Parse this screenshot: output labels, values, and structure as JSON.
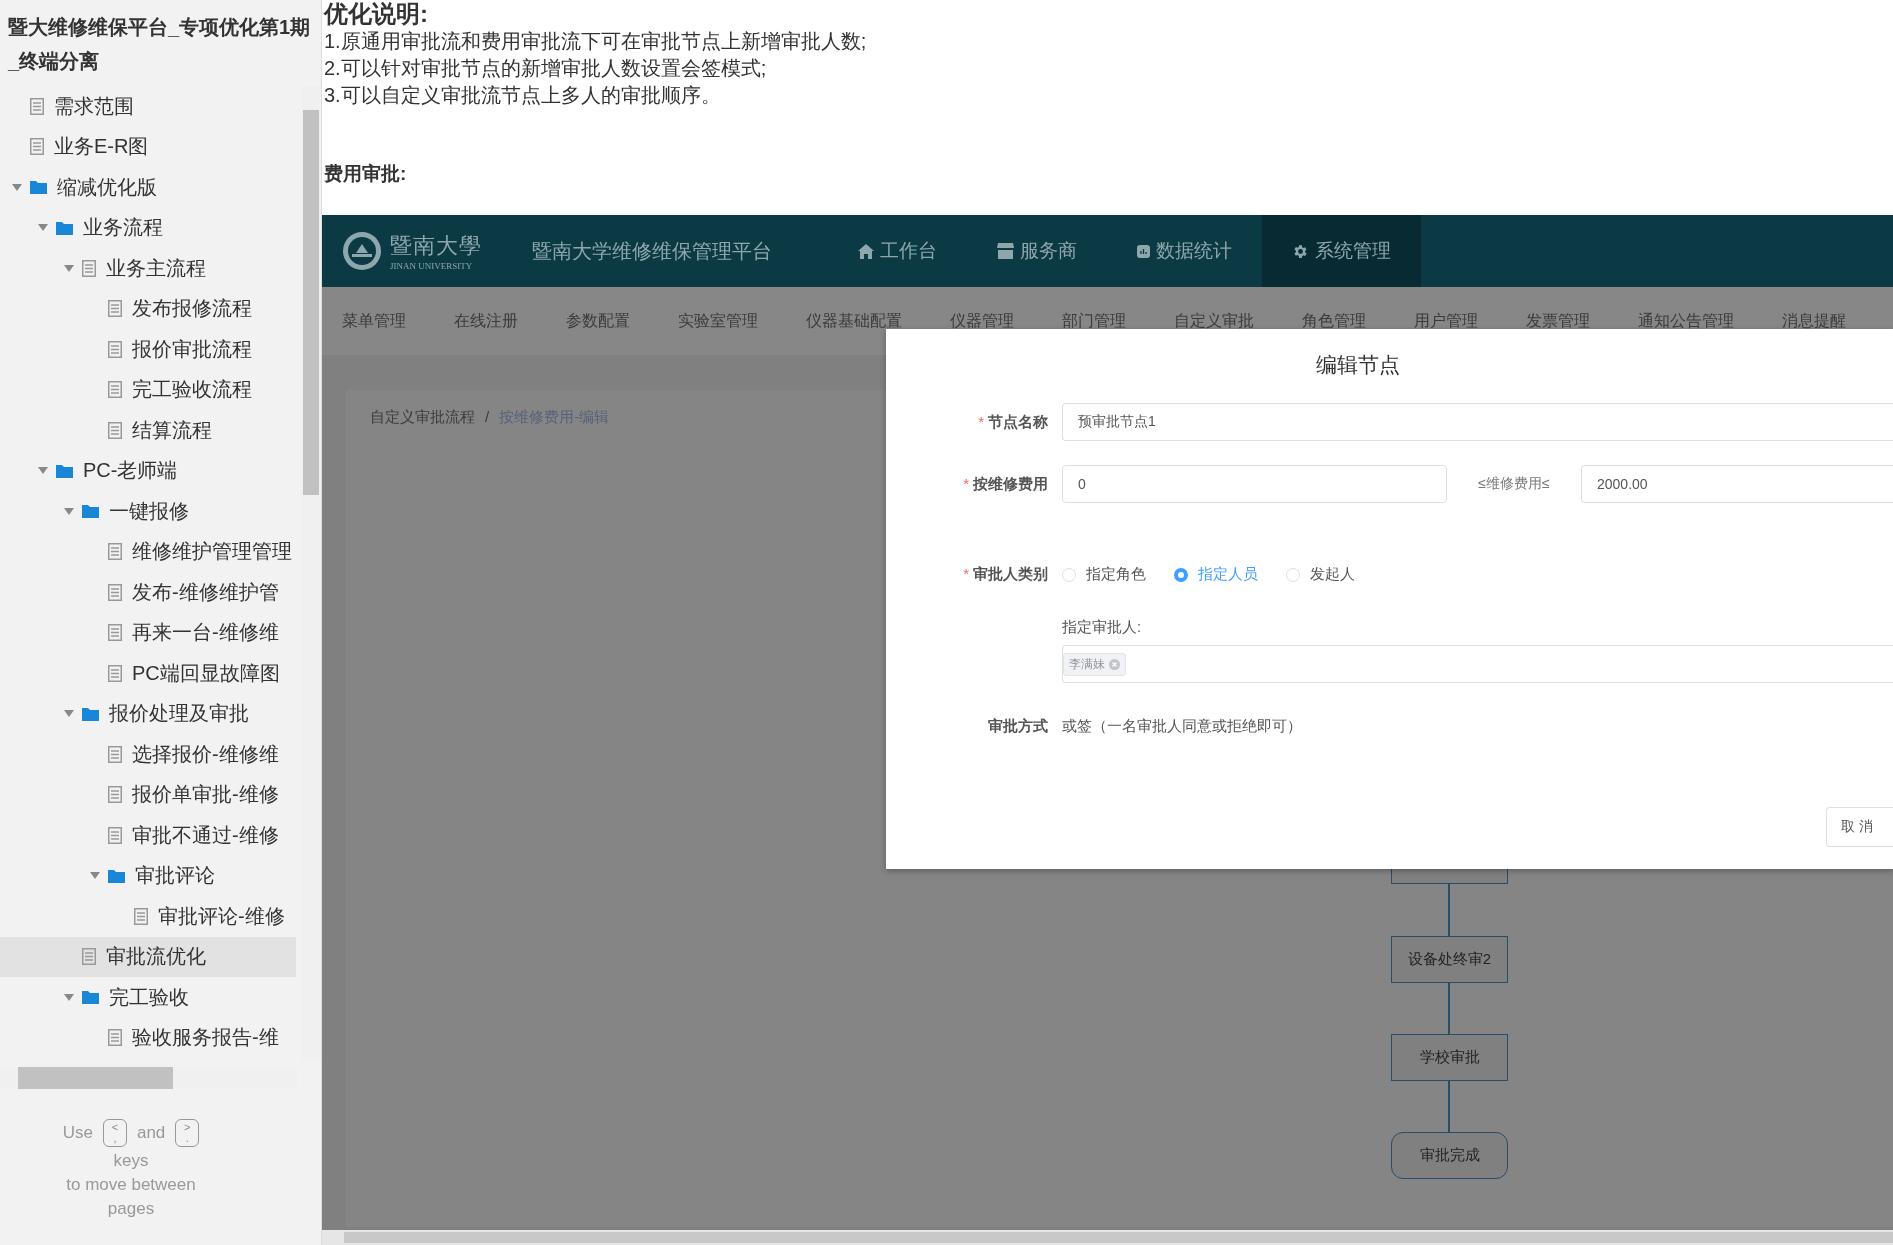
{
  "sidebar": {
    "title": "暨大维修维保平台_专项优化第1期_终端分离",
    "tree": [
      {
        "label": "需求范围",
        "kind": "page",
        "selected": false
      },
      {
        "label": "业务E-R图",
        "kind": "page",
        "selected": false
      },
      {
        "label": "缩减优化版",
        "kind": "folder",
        "expanded": true,
        "selected": false,
        "children": [
          {
            "label": "业务流程",
            "kind": "folder",
            "expanded": true,
            "selected": false,
            "children": [
              {
                "label": "业务主流程",
                "kind": "page",
                "expanded": true,
                "selected": false,
                "children": [
                  {
                    "label": "发布报修流程",
                    "kind": "page",
                    "selected": false
                  },
                  {
                    "label": "报价审批流程",
                    "kind": "page",
                    "selected": false
                  },
                  {
                    "label": "完工验收流程",
                    "kind": "page",
                    "selected": false
                  },
                  {
                    "label": "结算流程",
                    "kind": "page",
                    "selected": false
                  }
                ]
              }
            ]
          },
          {
            "label": "PC-老师端",
            "kind": "folder",
            "expanded": true,
            "selected": false,
            "children": [
              {
                "label": "一键报修",
                "kind": "folder",
                "expanded": true,
                "selected": false,
                "children": [
                  {
                    "label": "维修维护管理管理",
                    "kind": "page",
                    "selected": false
                  },
                  {
                    "label": "发布-维修维护管",
                    "kind": "page",
                    "selected": false
                  },
                  {
                    "label": "再来一台-维修维",
                    "kind": "page",
                    "selected": false
                  },
                  {
                    "label": "PC端回显故障图",
                    "kind": "page",
                    "selected": false
                  }
                ]
              },
              {
                "label": "报价处理及审批",
                "kind": "folder",
                "expanded": true,
                "selected": false,
                "children": [
                  {
                    "label": "选择报价-维修维",
                    "kind": "page",
                    "selected": false
                  },
                  {
                    "label": "报价单审批-维修",
                    "kind": "page",
                    "selected": false
                  },
                  {
                    "label": "审批不通过-维修",
                    "kind": "page",
                    "selected": false
                  },
                  {
                    "label": "审批评论",
                    "kind": "folder",
                    "expanded": true,
                    "selected": false,
                    "children": [
                      {
                        "label": "审批评论-维修",
                        "kind": "page",
                        "selected": false
                      }
                    ]
                  }
                ]
              },
              {
                "label": "审批流优化",
                "kind": "page",
                "selected": true
              },
              {
                "label": "完工验收",
                "kind": "folder",
                "expanded": true,
                "selected": false,
                "children": [
                  {
                    "label": "验收服务报告-维",
                    "kind": "page",
                    "selected": false
                  }
                ]
              }
            ]
          }
        ]
      }
    ],
    "footer": {
      "use": "Use",
      "keys": [
        {
          "top": "<",
          "bottom": ","
        },
        {
          "top": ">",
          "bottom": "."
        }
      ],
      "and": "and",
      "keys_word": "keys",
      "move": "to move between",
      "pages": "pages"
    }
  },
  "document": {
    "heading": "优化说明:",
    "lines": [
      "1.原通用审批流和费用审批流下可在审批节点上新增审批人数;",
      "2.可以针对审批节点的新增审批人数设置会签模式;",
      "3.可以自定义审批流节点上多人的审批顺序。"
    ],
    "section_title": "费用审批:"
  },
  "mockup": {
    "logo": {
      "text": "暨南大學",
      "subtext": "JINAN UNIVERSITY"
    },
    "app_title": "暨南大学维修维保管理平台",
    "nav": [
      {
        "label": "工作台",
        "kind": "home",
        "selected": false
      },
      {
        "label": "服务商",
        "kind": "store",
        "selected": false
      },
      {
        "label": "数据统计",
        "kind": "chart",
        "selected": false
      },
      {
        "label": "系统管理",
        "kind": "gear",
        "selected": true
      }
    ],
    "subnav": [
      "菜单管理",
      "在线注册",
      "参数配置",
      "实验室管理",
      "仪器基础配置",
      "仪器管理",
      "部门管理",
      "自定义审批",
      "角色管理",
      "用户管理",
      "发票管理",
      "通知公告管理",
      "消息提醒"
    ],
    "breadcrumb": [
      "自定义审批流程",
      "/",
      "按维修费用-编辑"
    ],
    "flow_nodes": [
      {
        "kind": "step"
      },
      {
        "kind": "step",
        "label": "设备处终审2"
      },
      {
        "kind": "step",
        "label": "学校审批"
      },
      {
        "kind": "end",
        "label": "审批完成"
      }
    ],
    "dialog": {
      "title": "编辑节点",
      "required_mark": "*",
      "name": {
        "label": "节点名称",
        "required": true,
        "value": "预审批节点1"
      },
      "fee": {
        "label": "按维修费用",
        "required": true,
        "min": "0",
        "separator": "≤维修费用≤",
        "max": "2000.00"
      },
      "approver_type": {
        "label": "审批人类别",
        "required": true,
        "options": [
          {
            "label": "指定角色",
            "selected": false
          },
          {
            "label": "指定人员",
            "selected": true
          },
          {
            "label": "发起人",
            "selected": false
          }
        ]
      },
      "approver": {
        "label": "指定审批人:",
        "tags": [
          "李满妹"
        ]
      },
      "method": {
        "label": "审批方式",
        "value": "或签（一名审批人同意或拒绝即可）"
      },
      "buttons": [
        "取 消"
      ]
    }
  }
}
